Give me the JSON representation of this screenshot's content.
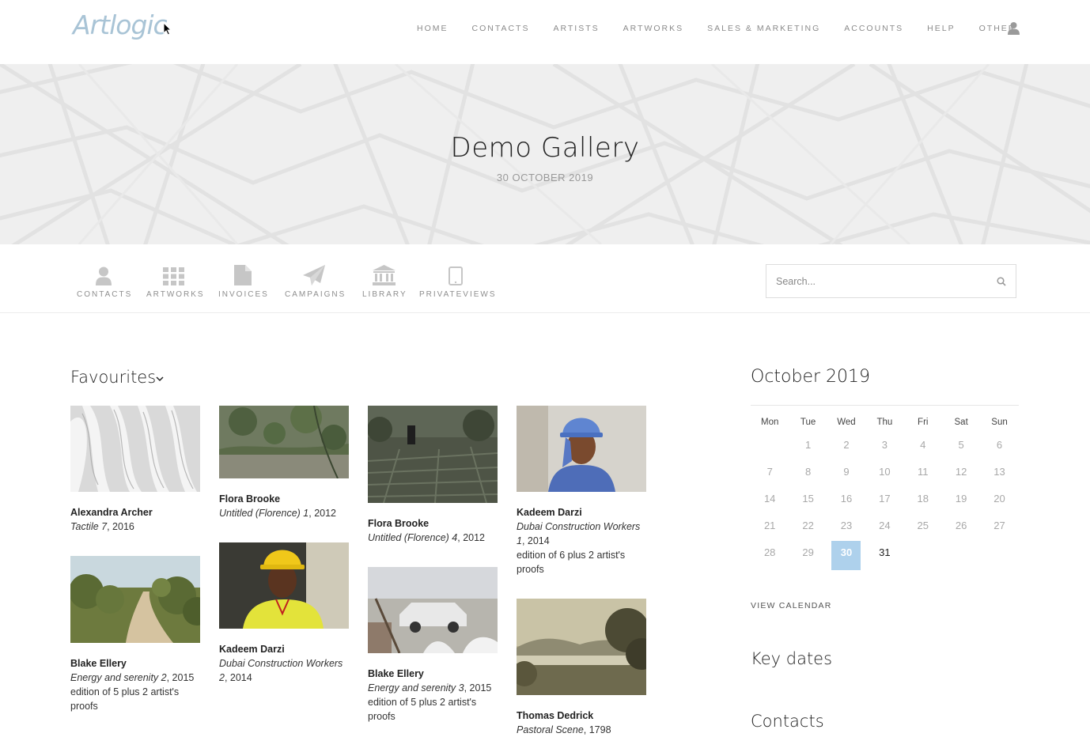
{
  "brand": {
    "logo_text": "Artlogic",
    "logo_color": "#a9c4d6"
  },
  "nav": [
    "HOME",
    "CONTACTS",
    "ARTISTS",
    "ARTWORKS",
    "SALES & MARKETING",
    "ACCOUNTS",
    "HELP",
    "OTHER"
  ],
  "hero": {
    "title": "Demo Gallery",
    "date": "30 OCTOBER 2019"
  },
  "toolbar": {
    "items": [
      "CONTACTS",
      "ARTWORKS",
      "INVOICES",
      "CAMPAIGNS",
      "LIBRARY",
      "PRIVATEVIEWS"
    ],
    "icons": [
      "person-icon",
      "grid-icon",
      "document-icon",
      "paper-plane-icon",
      "library-icon",
      "tablet-icon"
    ],
    "search_placeholder": "Search..."
  },
  "favourites": {
    "title": "Favourites",
    "cards": [
      {
        "artist": "Alexandra Archer",
        "title": "Tactile 7",
        "year": ", 2016",
        "edition": ""
      },
      {
        "artist": "Flora Brooke",
        "title": "Untitled (Florence) 1",
        "year": ", 2012",
        "edition": ""
      },
      {
        "artist": "Flora Brooke",
        "title": "Untitled (Florence) 4",
        "year": ", 2012",
        "edition": ""
      },
      {
        "artist": "Kadeem Darzi",
        "title": "Dubai Construction Workers 1",
        "year": ", 2014",
        "edition": "edition of 6 plus 2 artist's proofs"
      },
      {
        "artist": "Blake Ellery",
        "title": "Energy and serenity 2",
        "year": ", 2015",
        "edition": "edition of 5 plus 2 artist's proofs"
      },
      {
        "artist": "Kadeem Darzi",
        "title": "Dubai Construction Workers 2",
        "year": ", 2014",
        "edition": ""
      },
      {
        "artist": "Blake Ellery",
        "title": "Energy and serenity 3",
        "year": ", 2015",
        "edition": "edition of 5 plus 2 artist's proofs"
      },
      {
        "artist": "Thomas Dedrick",
        "title": "Pastoral Scene",
        "year": ", 1798",
        "edition": ""
      }
    ]
  },
  "calendar": {
    "title": "October 2019",
    "weekdays": [
      "Mon",
      "Tue",
      "Wed",
      "Thu",
      "Fri",
      "Sat",
      "Sun"
    ],
    "weeks": [
      [
        "",
        "1",
        "2",
        "3",
        "4",
        "5",
        "6"
      ],
      [
        "7",
        "8",
        "9",
        "10",
        "11",
        "12",
        "13"
      ],
      [
        "14",
        "15",
        "16",
        "17",
        "18",
        "19",
        "20"
      ],
      [
        "21",
        "22",
        "23",
        "24",
        "25",
        "26",
        "27"
      ],
      [
        "28",
        "29",
        "30",
        "31",
        "",
        "",
        ""
      ]
    ],
    "today": "30",
    "today_color": "#aed1ec",
    "view_link": "VIEW CALENDAR"
  },
  "key_dates_title": "Key dates",
  "contacts_title": "Contacts"
}
